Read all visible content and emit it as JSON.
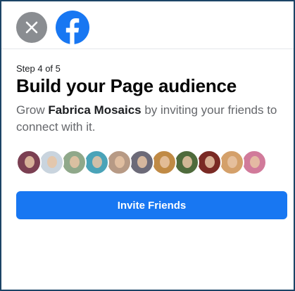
{
  "header": {
    "close_icon": "close-icon",
    "logo_icon": "facebook-logo-icon",
    "close_bg": "#8a8d91",
    "brand_color": "#1877f2"
  },
  "main": {
    "step": "Step 4 of 5",
    "title": "Build your Page audience",
    "desc_prefix": "Grow ",
    "page_name": "Fabrica Mosaics",
    "desc_suffix": " by inviting your friends to connect with it."
  },
  "avatars": [
    {
      "color": "#7b3f52"
    },
    {
      "color": "#c9d4de"
    },
    {
      "color": "#8fa88a"
    },
    {
      "color": "#4aa3b8"
    },
    {
      "color": "#b79a85"
    },
    {
      "color": "#6c6a78"
    },
    {
      "color": "#c08a45"
    },
    {
      "color": "#4f6b3c"
    },
    {
      "color": "#7a2a24"
    },
    {
      "color": "#d4a06a"
    },
    {
      "color": "#d17a9a"
    }
  ],
  "invite_button": {
    "label": "Invite Friends",
    "color": "#1877f2"
  }
}
